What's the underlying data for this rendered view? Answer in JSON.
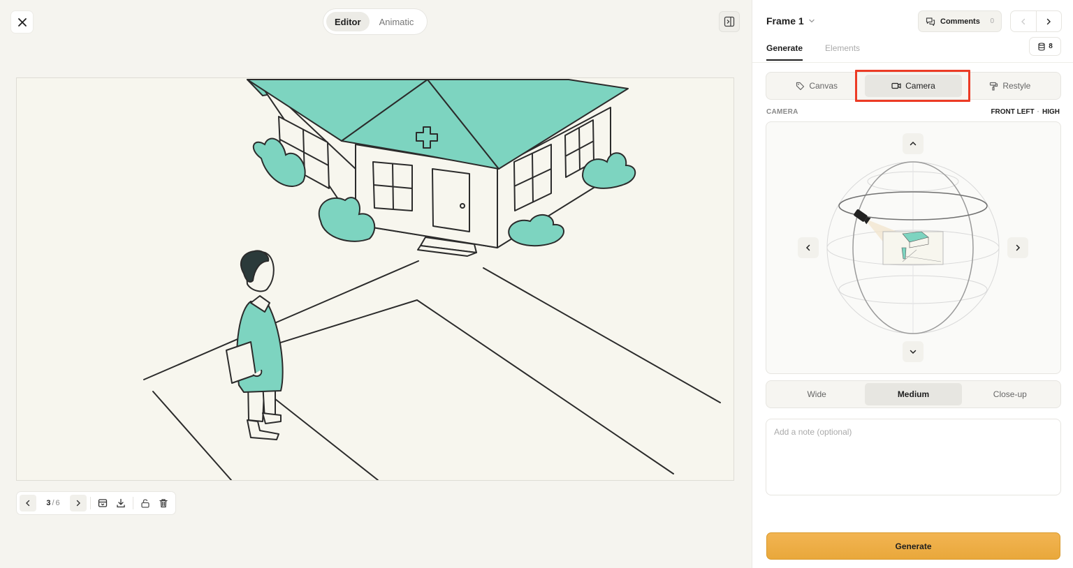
{
  "mode_switch": {
    "editor": "Editor",
    "animatic": "Animatic"
  },
  "pager": {
    "current": "3",
    "separator": "/",
    "total": "6"
  },
  "panel": {
    "frame_title": "Frame 1",
    "comments_label": "Comments",
    "comments_count": "0",
    "credits": "8",
    "tabs": {
      "generate": "Generate",
      "elements": "Elements"
    },
    "modes": {
      "canvas": "Canvas",
      "camera": "Camera",
      "restyle": "Restyle"
    },
    "camera": {
      "label": "CAMERA",
      "position": "FRONT LEFT",
      "dot": "·",
      "height": "HIGH"
    },
    "shot_sizes": {
      "wide": "Wide",
      "medium": "Medium",
      "closeup": "Close-up"
    },
    "note_placeholder": "Add a note (optional)",
    "generate_label": "Generate"
  },
  "colors": {
    "accent_teal": "#7dd4c0",
    "highlight_red": "#ec3b25",
    "generate_orange": "#eeae47"
  },
  "icons": {
    "close": "close-icon",
    "panel_toggle": "sidebar-toggle-icon",
    "comments": "chat-bubbles-icon",
    "credits": "database-icon",
    "canvas": "tag-icon",
    "camera": "video-camera-icon",
    "restyle": "paint-roller-icon"
  }
}
